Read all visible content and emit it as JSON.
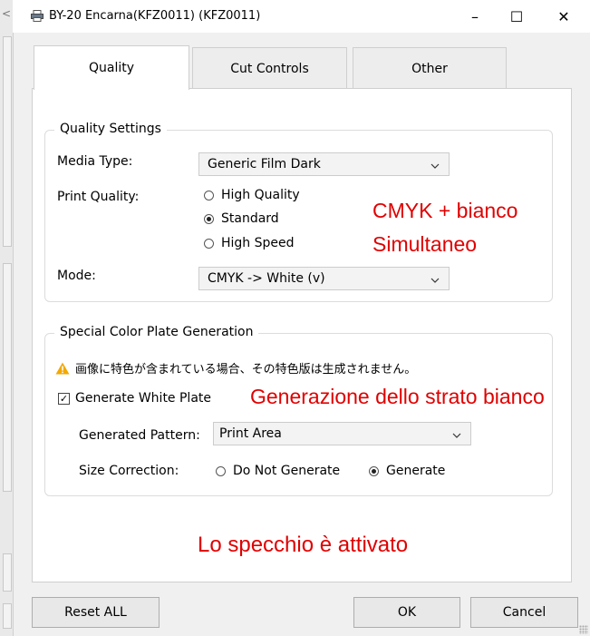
{
  "window": {
    "title": "BY-20 Encarna(KFZ0011) (KFZ0011)",
    "controls": [
      "–",
      "☐",
      "✕"
    ],
    "behind_window_glyph": "<"
  },
  "tabs": [
    {
      "label": "Quality",
      "active": true
    },
    {
      "label": "Cut Controls",
      "active": false
    },
    {
      "label": "Other",
      "active": false
    }
  ],
  "quality": {
    "group_title": "Quality Settings",
    "media_type_label": "Media Type:",
    "media_type_value": "Generic Film Dark",
    "print_quality_label": "Print Quality:",
    "print_quality_options": [
      {
        "label": "High Quality",
        "selected": false
      },
      {
        "label": "Standard",
        "selected": true
      },
      {
        "label": "High Speed",
        "selected": false
      }
    ],
    "mode_label": "Mode:",
    "mode_value": "CMYK -> White (v)"
  },
  "special": {
    "group_title": "Special Color Plate Generation",
    "warning": "画像に特色が含まれている場合、その特色版は生成されません。",
    "generate_white_label": "Generate White Plate",
    "generate_white_checked": true,
    "pattern_label": "Generated Pattern:",
    "pattern_value": "Print Area",
    "size_correction_label": "Size Correction:",
    "size_options": [
      {
        "label": "Do Not Generate",
        "selected": false
      },
      {
        "label": "Generate",
        "selected": true
      }
    ]
  },
  "annotations": {
    "cmyk": "CMYK + bianco",
    "simultaneo": "Simultaneo",
    "strato": "Generazione dello strato bianco",
    "specchio": "Lo specchio è attivato"
  },
  "buttons": {
    "reset": "Reset ALL",
    "ok": "OK",
    "cancel": "Cancel"
  },
  "colors": {
    "annotation_red": "#e00000",
    "warning_orange": "#f2a900"
  }
}
